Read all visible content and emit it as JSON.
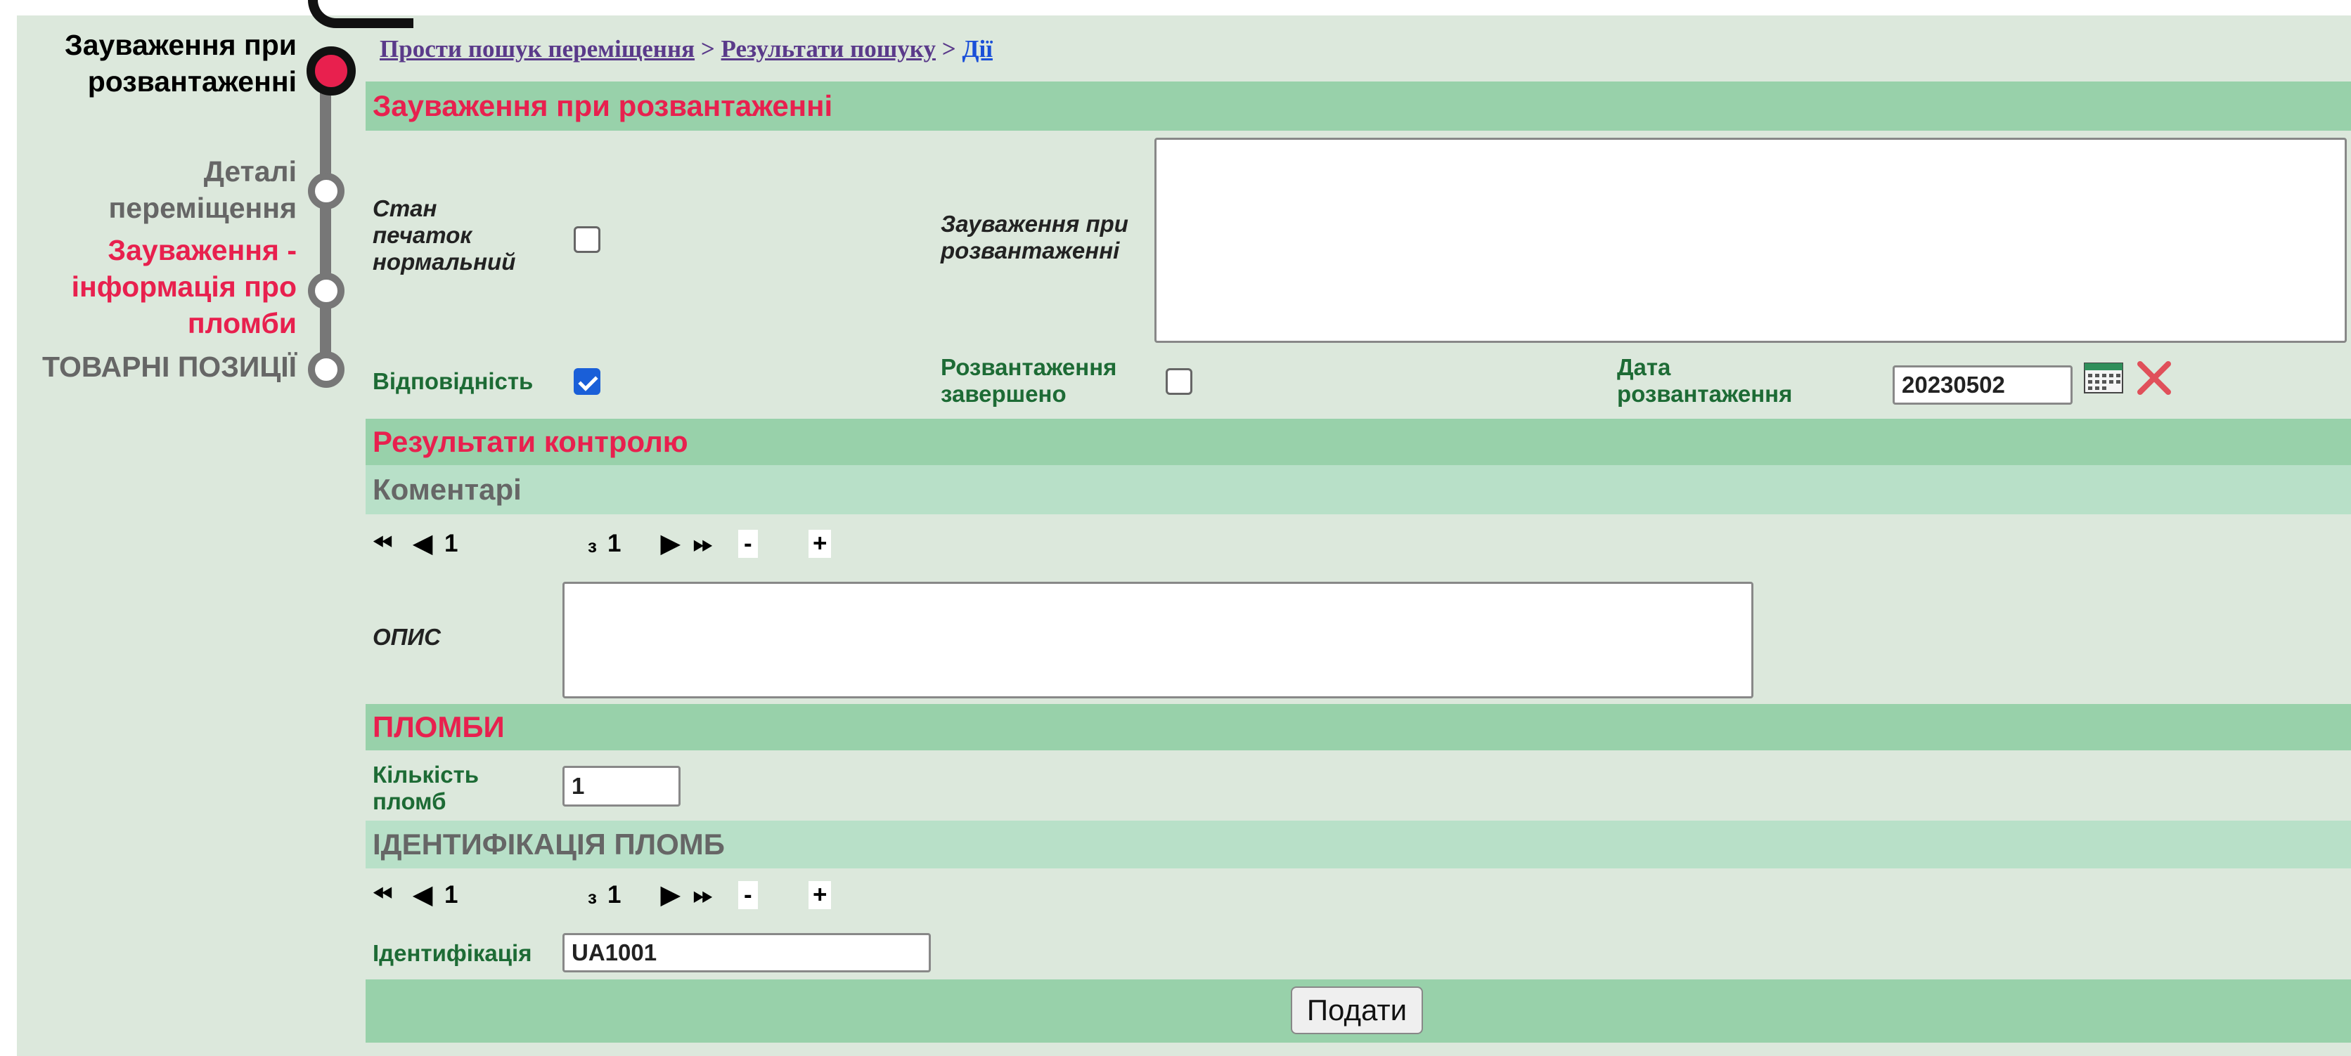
{
  "nav": {
    "items": [
      {
        "label_line1": "Зауваження при",
        "label_line2": "розвантаженні"
      },
      {
        "label_line1": "Деталі",
        "label_line2": "переміщення"
      },
      {
        "label_line1": "Зауваження -",
        "label_line2": "інформація про",
        "label_line3": "пломби"
      },
      {
        "label_line1": "ТОВАРНІ ПОЗИЦІЇ"
      }
    ]
  },
  "breadcrumb": {
    "item1": "Прости пошук переміщення",
    "sep1": " > ",
    "item2": "Результати пошуку",
    "sep2": " > ",
    "item3": "Дії"
  },
  "unloading": {
    "section_title": "Зауваження при розвантаженні",
    "seals_ok_label_1": "Стан",
    "seals_ok_label_2": "печаток",
    "seals_ok_label_3": "нормальний",
    "remarks_label_1": "Зауваження при",
    "remarks_label_2": "розвантаженні",
    "remarks_value": "",
    "conformity_label": "Відповідність",
    "conformity_checked": true,
    "completed_label_1": "Розвантаження",
    "completed_label_2": "завершено",
    "completed_checked": false,
    "date_label_1": "Дата",
    "date_label_2": "розвантаження",
    "date_value": "20230502"
  },
  "control": {
    "section_title": "Результати контролю",
    "comments_title": "Коментарі",
    "pager": {
      "current": "1",
      "of": "з",
      "total": "1",
      "minus": "-",
      "plus": "+"
    },
    "description_label": "ОПИС",
    "description_value": ""
  },
  "seals": {
    "section_title": "ПЛОМБИ",
    "count_label_1": "Кількість",
    "count_label_2": "пломб",
    "count_value": "1",
    "ident_title": "ІДЕНТИФІКАЦІЯ ПЛОМБ",
    "pager": {
      "current": "1",
      "of": "з",
      "total": "1",
      "minus": "-",
      "plus": "+"
    },
    "ident_label": "Ідентифікація",
    "ident_value": "UA1001"
  },
  "actions": {
    "submit_label": "Подати"
  },
  "colors": {
    "accent_red": "#e8204e",
    "section_green": "#98d1aa",
    "label_green": "#1d6b35",
    "check_blue": "#1a5fd8"
  }
}
